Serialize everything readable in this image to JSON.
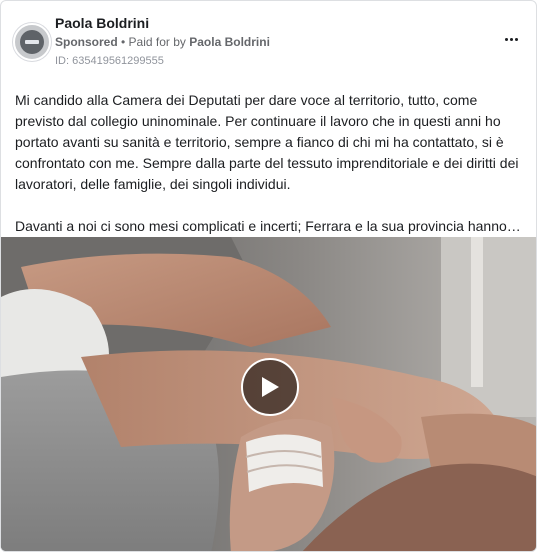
{
  "post": {
    "page_name": "Paola Boldrini",
    "sponsored_label": "Sponsored",
    "separator": " • ",
    "paid_for_label": "Paid for by ",
    "payer_name": "Paola Boldrini",
    "ad_id": "ID: 635419561299555",
    "avatar_icon": "avatar-icon",
    "more_icon": "more-options-icon",
    "body": {
      "paragraph_1": "Mi candido alla Camera dei Deputati per dare voce al territorio, tutto, come previsto dal collegio uninominale. Per continuare il lavoro che in questi anni ho portato avanti su sanità e territorio, sempre a fianco di chi mi ha contattato, si è confrontato con me. Sempre dalla parte del tessuto imprenditoriale e dei diritti dei lavoratori, delle famiglie, dei singoli individui.",
      "paragraph_2": "Davanti a noi ci sono mesi complicati e incerti; Ferrara e la sua provincia hanno…"
    },
    "video": {
      "play_icon": "play-icon"
    }
  }
}
